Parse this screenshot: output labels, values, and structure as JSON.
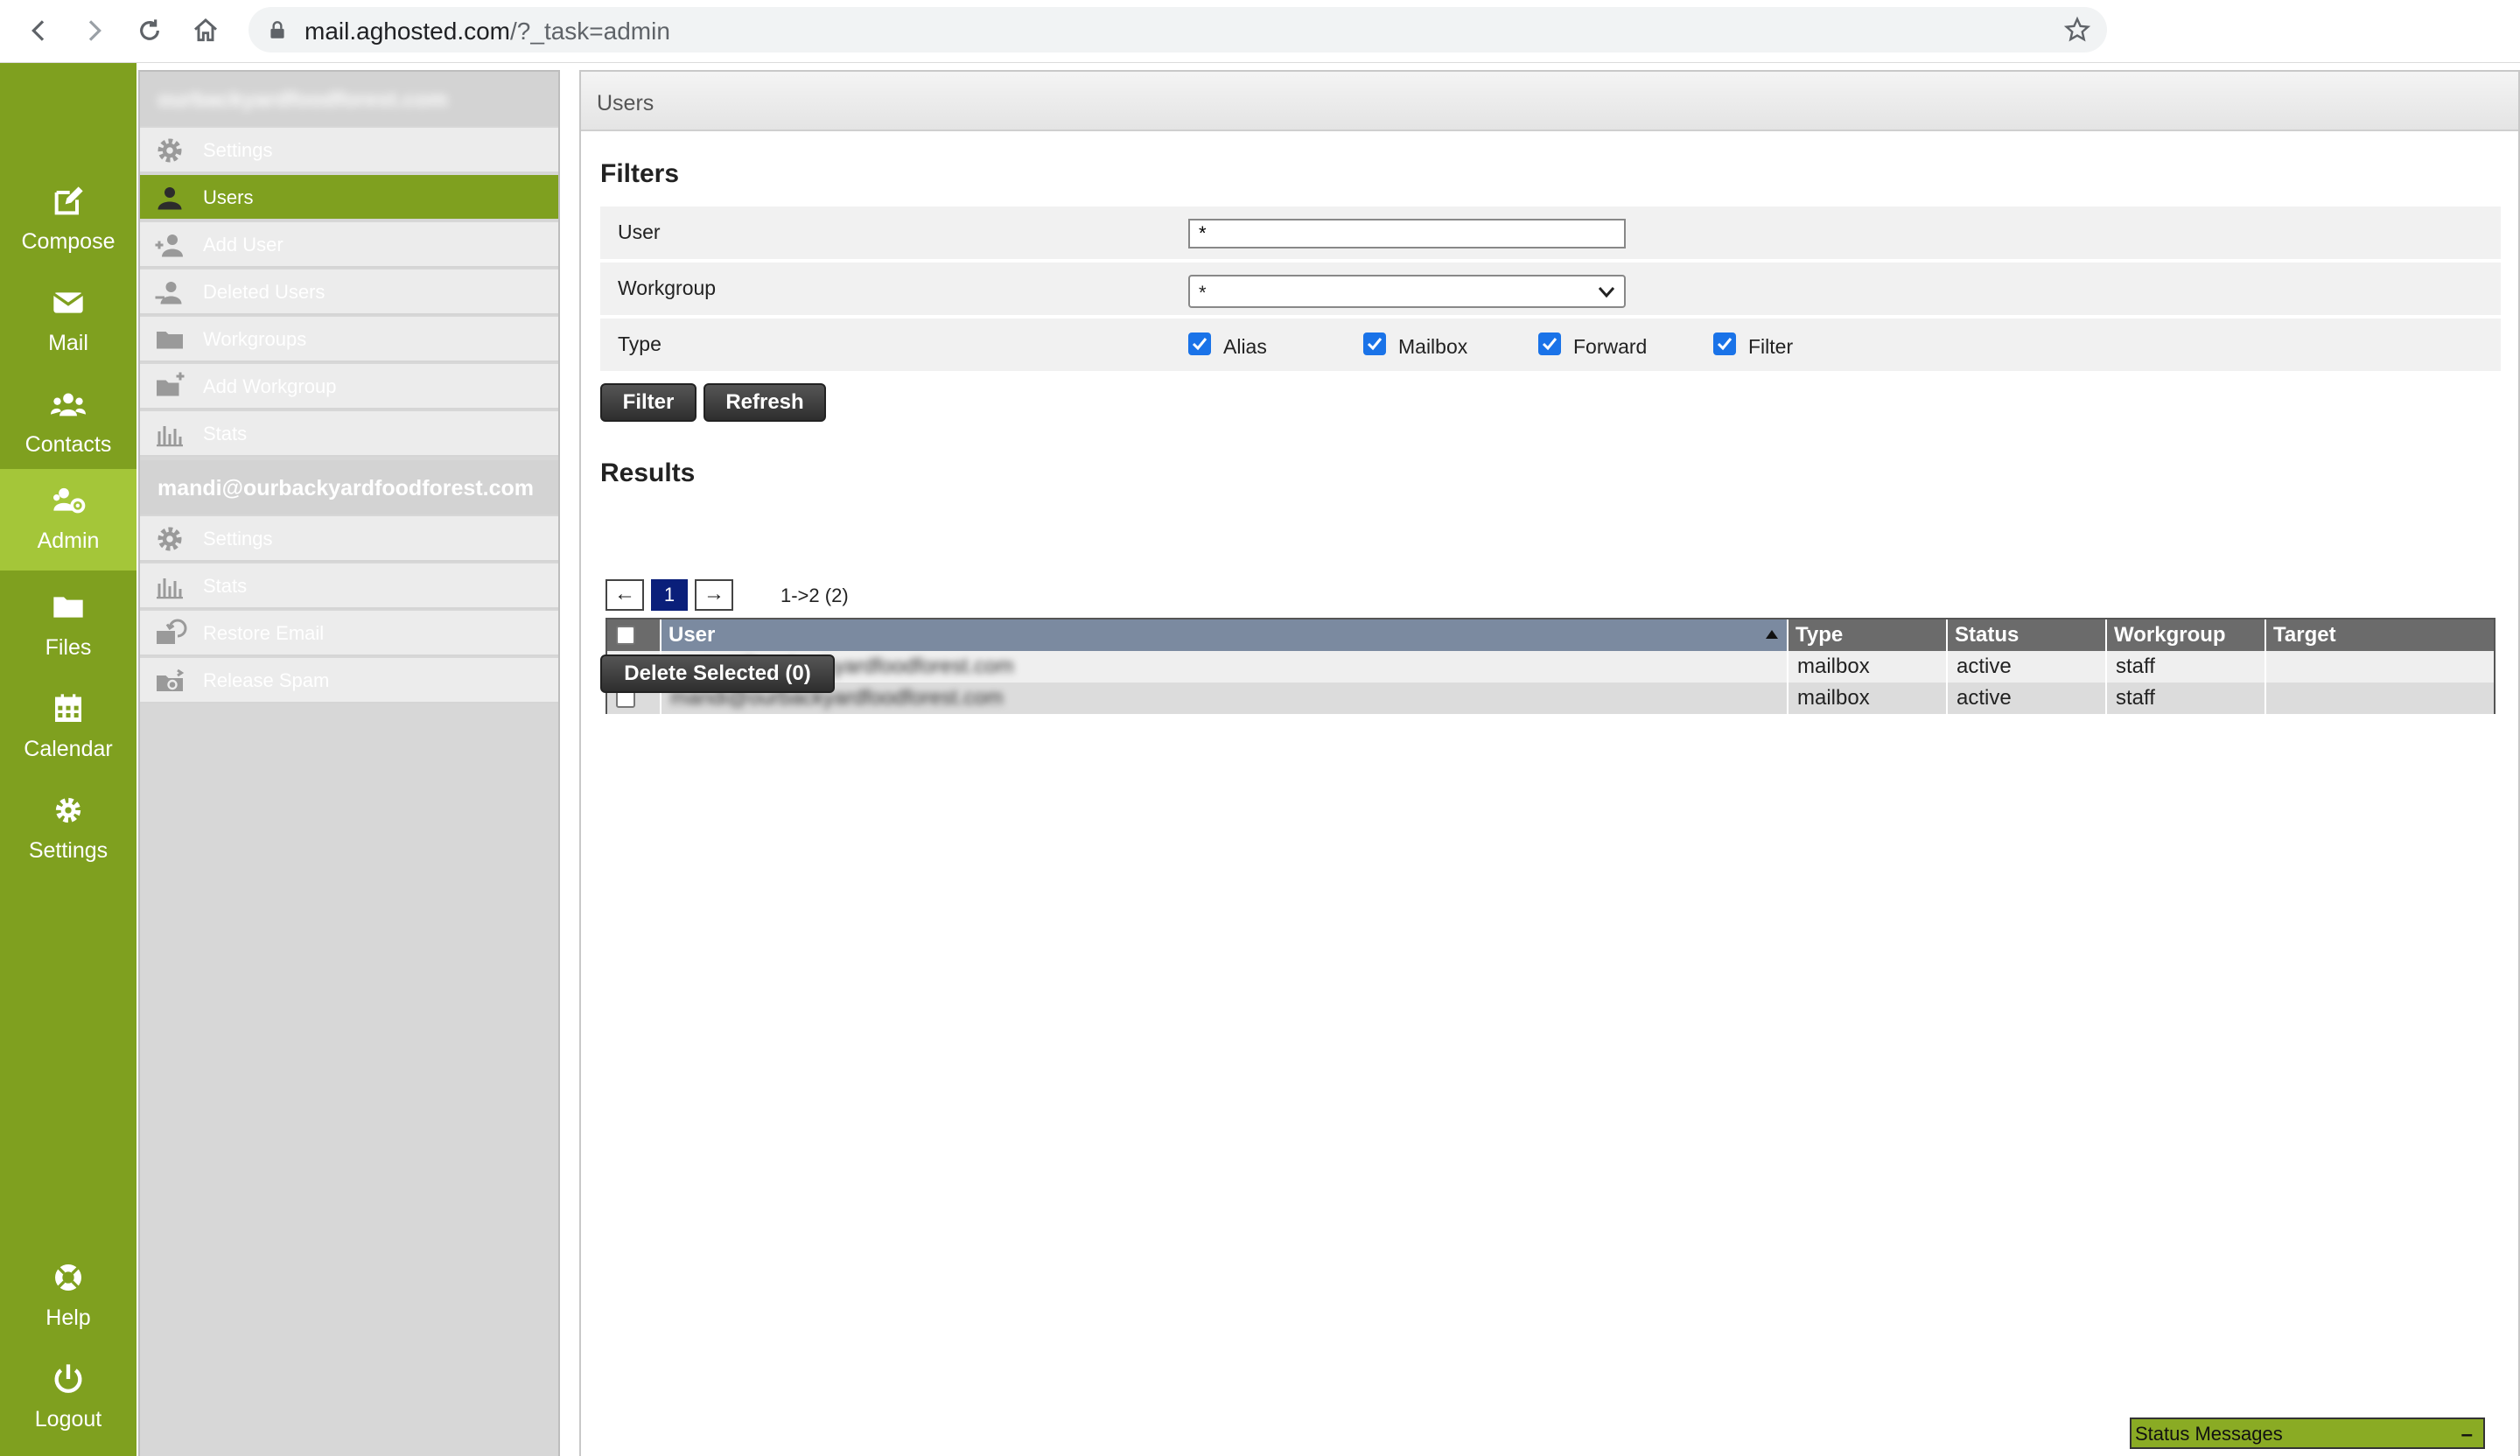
{
  "browser": {
    "url_host": "mail.aghosted.com",
    "url_path": "/?_task=admin"
  },
  "appbar": {
    "items": [
      {
        "label": "Compose",
        "icon": "compose-icon"
      },
      {
        "label": "Mail",
        "icon": "envelope-icon"
      },
      {
        "label": "Contacts",
        "icon": "contacts-icon"
      },
      {
        "label": "Admin",
        "icon": "admin-icon",
        "active": true
      },
      {
        "label": "Files",
        "icon": "folder-icon"
      },
      {
        "label": "Calendar",
        "icon": "calendar-icon"
      },
      {
        "label": "Settings",
        "icon": "gear-icon"
      },
      {
        "label": "Help",
        "icon": "lifebuoy-icon"
      },
      {
        "label": "Logout",
        "icon": "power-icon"
      }
    ],
    "accent": "#7fa01f",
    "active_bg": "#a4c639"
  },
  "sidebar": {
    "domain_header": "ourbackyardfoodforest.com",
    "domain_items": [
      {
        "label": "Settings",
        "icon": "gear-icon"
      },
      {
        "label": "Users",
        "icon": "users-icon",
        "active": true
      },
      {
        "label": "Add User",
        "icon": "add-user-icon"
      },
      {
        "label": "Deleted Users",
        "icon": "deleted-users-icon"
      },
      {
        "label": "Workgroups",
        "icon": "folder-icon"
      },
      {
        "label": "Add Workgroup",
        "icon": "add-folder-icon"
      },
      {
        "label": "Stats",
        "icon": "bar-chart-icon"
      }
    ],
    "account_header": "mandi@ourbackyardfoodforest.com",
    "account_items": [
      {
        "label": "Settings",
        "icon": "gear-icon"
      },
      {
        "label": "Stats",
        "icon": "bar-chart-icon"
      },
      {
        "label": "Restore Email",
        "icon": "restore-icon"
      },
      {
        "label": "Release Spam",
        "icon": "release-icon"
      }
    ]
  },
  "main": {
    "title": "Users",
    "filters": {
      "title": "Filters",
      "user_label": "User",
      "user_value": "*",
      "workgroup_label": "Workgroup",
      "workgroup_value": "*",
      "type_label": "Type",
      "types": [
        {
          "label": "Alias",
          "checked": true
        },
        {
          "label": "Mailbox",
          "checked": true
        },
        {
          "label": "Forward",
          "checked": true
        },
        {
          "label": "Filter",
          "checked": true
        }
      ],
      "filter_button": "Filter",
      "refresh_button": "Refresh"
    },
    "results": {
      "title": "Results",
      "pager_prev": "←",
      "pager_current": "1",
      "pager_next": "→",
      "pager_range": "1->2 (2)",
      "columns": [
        "User",
        "Type",
        "Status",
        "Workgroup",
        "Target"
      ],
      "rows": [
        {
          "user": "contact@ourbackyardfoodforest.com",
          "type": "mailbox",
          "status": "active",
          "workgroup": "staff",
          "target": ""
        },
        {
          "user": "mandi@ourbackyardfoodforest.com",
          "type": "mailbox",
          "status": "active",
          "workgroup": "staff",
          "target": ""
        }
      ],
      "delete_button": "Delete Selected (0)"
    }
  },
  "status": {
    "title": "Status Messages",
    "minimize": "–"
  }
}
